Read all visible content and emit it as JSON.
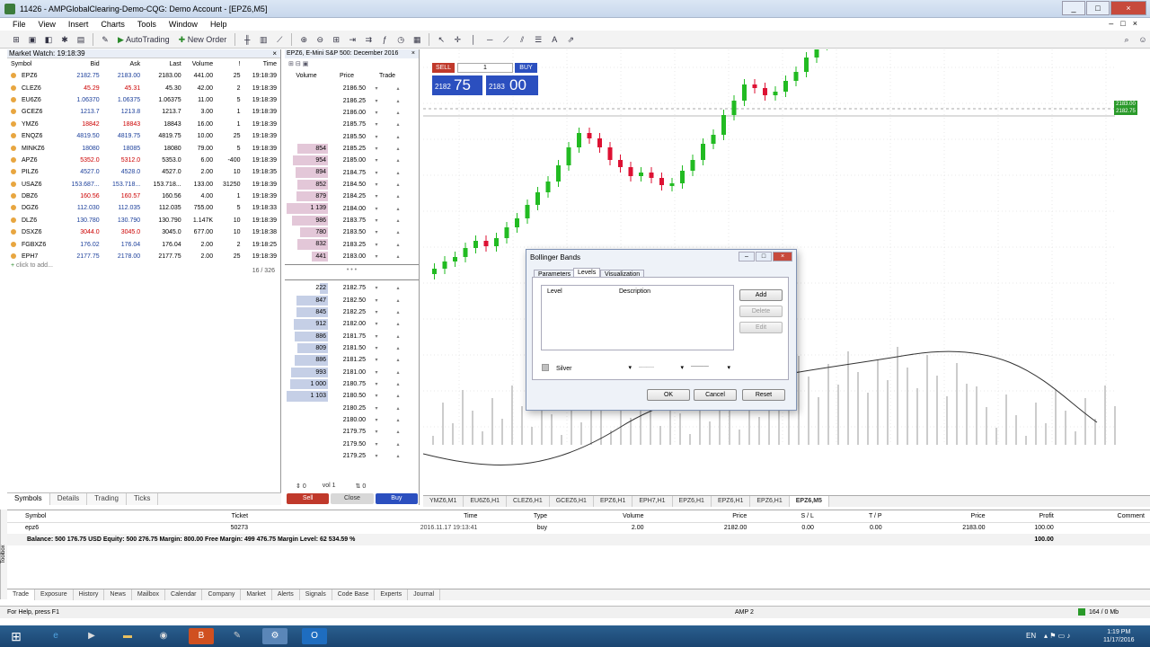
{
  "window": {
    "title": "11426 - AMPGlobalClearing-Demo-CQG: Demo Account - [EPZ6,M5]",
    "buttons": [
      "_",
      "□",
      "×"
    ]
  },
  "menu": [
    "File",
    "View",
    "Insert",
    "Charts",
    "Tools",
    "Window",
    "Help"
  ],
  "toolbar": {
    "autotrading": "AutoTrading",
    "new_order": "New Order"
  },
  "market_watch": {
    "title": "Market Watch: 19:18:39",
    "columns": [
      "Symbol",
      "Bid",
      "Ask",
      "Last",
      "Volume",
      "!",
      "Time"
    ],
    "rows": [
      [
        "EPZ6",
        "2182.75",
        "2183.00",
        "2183.00",
        "441.00",
        "25",
        "19:18:39"
      ],
      [
        "CLEZ6",
        "45.29",
        "45.31",
        "45.30",
        "42.00",
        "2",
        "19:18:39"
      ],
      [
        "EU6Z6",
        "1.06370",
        "1.06375",
        "1.06375",
        "11.00",
        "5",
        "19:18:39"
      ],
      [
        "GCEZ6",
        "1213.7",
        "1213.8",
        "1213.7",
        "3.00",
        "1",
        "19:18:39"
      ],
      [
        "YMZ6",
        "18842",
        "18843",
        "18843",
        "16.00",
        "1",
        "19:18:39"
      ],
      [
        "ENQZ6",
        "4819.50",
        "4819.75",
        "4819.75",
        "10.00",
        "25",
        "19:18:39"
      ],
      [
        "MINKZ6",
        "18080",
        "18085",
        "18080",
        "79.00",
        "5",
        "19:18:39"
      ],
      [
        "APZ6",
        "5352.0",
        "5312.0",
        "5353.0",
        "6.00",
        "-400",
        "19:18:39"
      ],
      [
        "PILZ6",
        "4527.0",
        "4528.0",
        "4527.0",
        "2.00",
        "10",
        "19:18:35"
      ],
      [
        "USAZ6",
        "153.687...",
        "153.718...",
        "153.718...",
        "133.00",
        "31250",
        "19:18:39"
      ],
      [
        "DBZ6",
        "160.56",
        "160.57",
        "160.56",
        "4.00",
        "1",
        "19:18:39"
      ],
      [
        "DGZ6",
        "112.030",
        "112.035",
        "112.035",
        "755.00",
        "5",
        "19:18:33"
      ],
      [
        "DLZ6",
        "130.780",
        "130.790",
        "130.790",
        "1.147K",
        "10",
        "19:18:39"
      ],
      [
        "DSXZ6",
        "3044.0",
        "3045.0",
        "3045.0",
        "677.00",
        "10",
        "19:18:38"
      ],
      [
        "FGBXZ6",
        "176.02",
        "176.04",
        "176.04",
        "2.00",
        "2",
        "19:18:25"
      ],
      [
        "EPH7",
        "2177.75",
        "2178.00",
        "2177.75",
        "2.00",
        "25",
        "19:18:39"
      ]
    ],
    "add_label": "click to add...",
    "count": "16 / 326",
    "tabs": [
      "Symbols",
      "Details",
      "Trading",
      "Ticks"
    ]
  },
  "dom": {
    "title": "EPZ6, E-Mini S&P 500: December 2016",
    "columns": [
      "Volume",
      "Price",
      "Trade"
    ],
    "asks": [
      [
        "",
        "2186.50"
      ],
      [
        "",
        "2186.25"
      ],
      [
        "",
        "2186.00"
      ],
      [
        "",
        "2185.75"
      ],
      [
        "",
        "2185.50"
      ],
      [
        "854",
        "2185.25"
      ],
      [
        "954",
        "2185.00"
      ],
      [
        "894",
        "2184.75"
      ],
      [
        "852",
        "2184.50"
      ],
      [
        "879",
        "2184.25"
      ],
      [
        "1 139",
        "2184.00"
      ],
      [
        "986",
        "2183.75"
      ],
      [
        "780",
        "2183.50"
      ],
      [
        "832",
        "2183.25"
      ],
      [
        "441",
        "2183.00"
      ]
    ],
    "bids": [
      [
        "222",
        "2182.75"
      ],
      [
        "847",
        "2182.50"
      ],
      [
        "845",
        "2182.25"
      ],
      [
        "912",
        "2182.00"
      ],
      [
        "886",
        "2181.75"
      ],
      [
        "809",
        "2181.50"
      ],
      [
        "886",
        "2181.25"
      ],
      [
        "993",
        "2181.00"
      ],
      [
        "1 000",
        "2180.75"
      ],
      [
        "1 103",
        "2180.50"
      ],
      [
        "",
        "2180.25"
      ],
      [
        "",
        "2180.00"
      ],
      [
        "",
        "2179.75"
      ],
      [
        "",
        "2179.50"
      ],
      [
        "",
        "2179.25"
      ]
    ],
    "qty": "0",
    "vol_label": "vol",
    "vol_value": "1",
    "ticks_value": "0",
    "sell_label": "Sell",
    "close_label": "Close",
    "buy_label": "Buy"
  },
  "one_click": {
    "sell_label": "SELL",
    "buy_label": "BUY",
    "lot": "1",
    "bid_prefix": "2182",
    "bid_big": "75",
    "ask_prefix": "2183",
    "ask_big": "00"
  },
  "chart_tabs": [
    "YMZ6,M1",
    "EU6Z6,H1",
    "CLEZ6,H1",
    "GCEZ6,H1",
    "EPZ6,H1",
    "EPH7,H1",
    "EPZ6,H1",
    "EPZ6,H1",
    "EPZ6,H1",
    "EPZ6,M5"
  ],
  "price_tags": [
    "2183.00",
    "2182.75"
  ],
  "dialog": {
    "title": "Bollinger Bands",
    "tabs": [
      "Parameters",
      "Levels",
      "Visualization"
    ],
    "list_columns": [
      "Level",
      "Description"
    ],
    "buttons": {
      "add": "Add",
      "delete": "Delete",
      "edit": "Edit",
      "ok": "OK",
      "cancel": "Cancel",
      "reset": "Reset"
    },
    "color_name": "Silver"
  },
  "terminal": {
    "columns": [
      "Symbol",
      "Ticket",
      "Time",
      "Type",
      "Volume",
      "Price",
      "S / L",
      "T / P",
      "Price",
      "Profit",
      "Comment"
    ],
    "row": [
      "epz6",
      "50273",
      "2016.11.17 19:13:41",
      "buy",
      "2.00",
      "2182.00",
      "0.00",
      "0.00",
      "2183.00",
      "100.00",
      ""
    ],
    "balance": "Balance: 500 176.75 USD  Equity: 500 276.75  Margin: 800.00  Free Margin: 499 476.75  Margin Level: 62 534.59 %",
    "balance_profit": "100.00",
    "toolbox_label": "Toolbox",
    "tabs": [
      "Trade",
      "Exposure",
      "History",
      "News",
      "Mailbox",
      "Calendar",
      "Company",
      "Market",
      "Alerts",
      "Signals",
      "Code Base",
      "Experts",
      "Journal"
    ]
  },
  "status": {
    "help": "For Help, press F1",
    "profile": "AMP 2",
    "traffic": "164 / 0 Mb"
  },
  "taskbar": {
    "lang": "EN",
    "time": "1:19 PM",
    "date": "11/17/2016"
  },
  "colors": {
    "bull": "#22bb22",
    "bear": "#dd1133",
    "sell": "#c0392b",
    "buy": "#2b4fbf",
    "ask_bar": "#e3c7d8",
    "bid_bar": "#c5cfe6"
  }
}
